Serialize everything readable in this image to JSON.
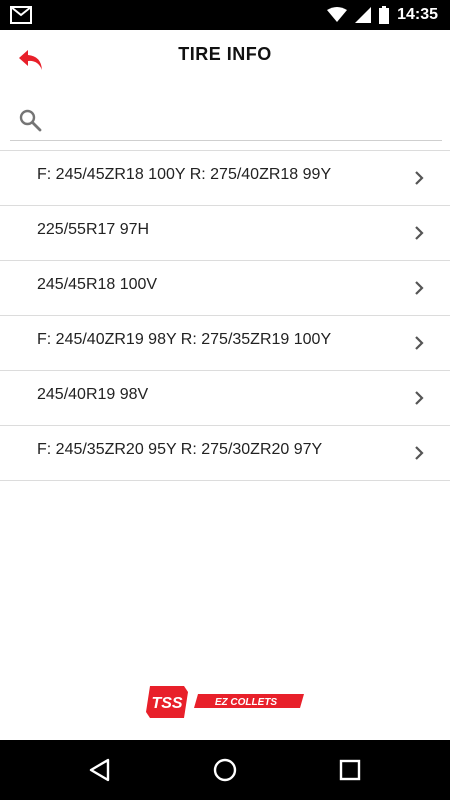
{
  "status_bar": {
    "time": "14:35",
    "icons": [
      "mail-icon",
      "wifi-icon",
      "signal-icon",
      "battery-icon"
    ]
  },
  "header": {
    "title": "TIRE INFO",
    "back_icon": "back-arrow-icon"
  },
  "search": {
    "placeholder": "",
    "value": "",
    "icon": "search-icon"
  },
  "tires": [
    {
      "label": "F: 245/45ZR18 100Y R: 275/40ZR18 99Y"
    },
    {
      "label": "225/55R17 97H"
    },
    {
      "label": "245/45R18 100V"
    },
    {
      "label": "F: 245/40ZR19 98Y R: 275/35ZR19 100Y"
    },
    {
      "label": "245/40R19 98V"
    },
    {
      "label": "F: 245/35ZR20 95Y R: 275/30ZR20 97Y"
    }
  ],
  "footer": {
    "logo_text": "TSS",
    "logo_subtext": "EZ COLLETS"
  },
  "nav_bar": {
    "buttons": [
      "back-triangle-icon",
      "home-circle-icon",
      "recents-square-icon"
    ]
  },
  "colors": {
    "accent": "#e8202a",
    "status_bar": "#000000",
    "nav_bar": "#000000"
  }
}
